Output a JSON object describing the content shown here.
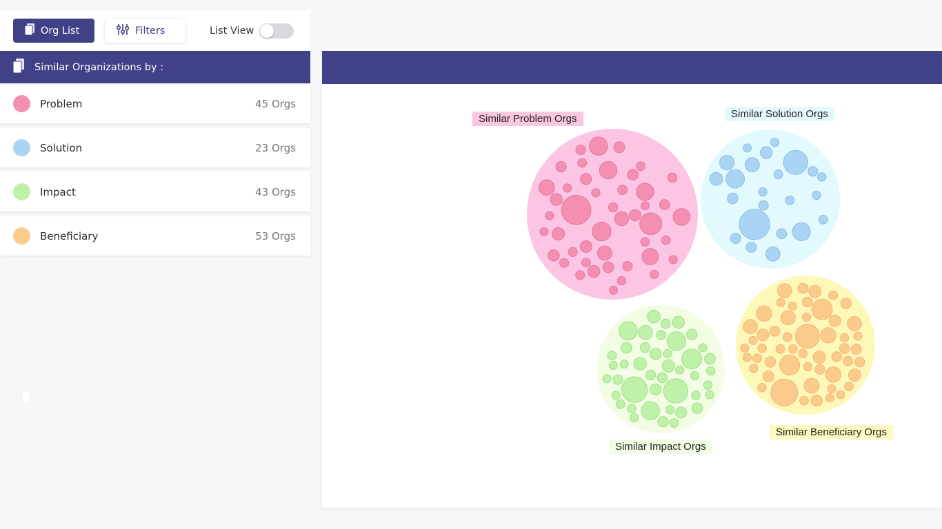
{
  "toolbar": {
    "org_list_label": "Org List",
    "filters_label": "Filters",
    "list_view_label": "List View",
    "list_view_on": false
  },
  "similar_header": {
    "title": "Similar Organizations by :"
  },
  "categories": [
    {
      "label": "Problem",
      "count": "45 Orgs",
      "color": "#f48fb1"
    },
    {
      "label": "Solution",
      "count": "23 Orgs",
      "color": "#a9d4f3"
    },
    {
      "label": "Impact",
      "count": "43 Orgs",
      "color": "#bff2a8"
    },
    {
      "label": "Beneficiary",
      "count": "53 Orgs",
      "color": "#fbcb8c"
    }
  ],
  "clusters": {
    "problem": {
      "label": "Similar Problem Orgs",
      "bg": "#fcc5e3",
      "bubble": "#f48fb1",
      "label_bg": "#fbc6df"
    },
    "solution": {
      "label": "Similar Solution Orgs",
      "bg": "#e2f9fd",
      "bubble": "#a9d4f3",
      "label_bg": "#e5f9fc"
    },
    "impact": {
      "label": "Similar Impact Orgs",
      "bg": "#f2fde4",
      "bubble": "#bff2a8",
      "label_bg": "#f3fde3"
    },
    "beneficiary": {
      "label": "Similar Beneficiary Orgs",
      "bg": "#fdf7b8",
      "bubble": "#fbcb8c",
      "label_bg": "#fdf8bf"
    }
  },
  "colors": {
    "accent": "#414188"
  }
}
